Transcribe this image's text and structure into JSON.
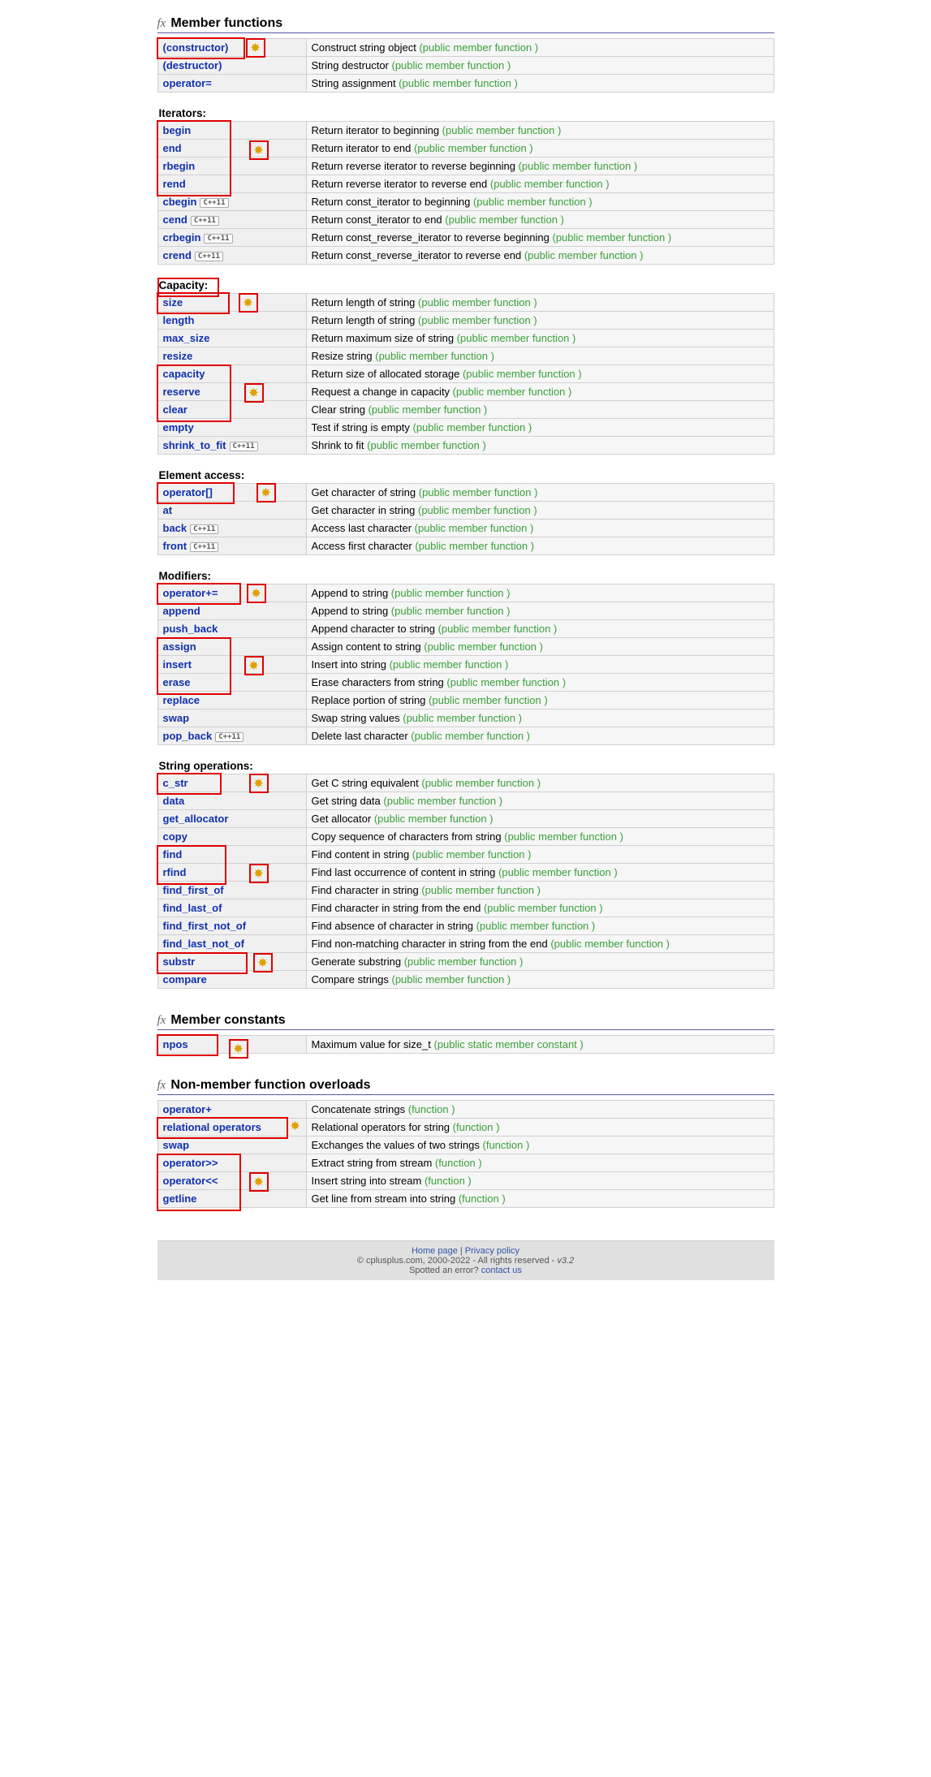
{
  "headings": {
    "member_functions": "Member functions",
    "member_constants": "Member constants",
    "nonmember_overloads": "Non-member function overloads"
  },
  "subheads": {
    "iterators": "Iterators:",
    "capacity": "Capacity:",
    "element_access": "Element access:",
    "modifiers": "Modifiers:",
    "string_operations": "String operations:"
  },
  "type_labels": {
    "pmf": "(public member function )",
    "psmc": "(public static member constant )",
    "fn": "(function )"
  },
  "cpp11_tag": "C++11",
  "member_functions_rows": [
    {
      "name": "(constructor)",
      "desc": "Construct string object",
      "type": "pmf",
      "hl_name": true,
      "star": true
    },
    {
      "name": "(destructor)",
      "desc": "String destructor",
      "type": "pmf"
    },
    {
      "name": "operator=",
      "desc": "String assignment",
      "type": "pmf"
    }
  ],
  "iterators_rows": [
    {
      "name": "begin",
      "desc": "Return iterator to beginning",
      "type": "pmf"
    },
    {
      "name": "end",
      "desc": "Return iterator to end",
      "type": "pmf"
    },
    {
      "name": "rbegin",
      "desc": "Return reverse iterator to reverse beginning",
      "type": "pmf"
    },
    {
      "name": "rend",
      "desc": "Return reverse iterator to reverse end",
      "type": "pmf"
    },
    {
      "name": "cbegin",
      "desc": "Return const_iterator to beginning",
      "type": "pmf",
      "cpp11": true
    },
    {
      "name": "cend",
      "desc": "Return const_iterator to end",
      "type": "pmf",
      "cpp11": true
    },
    {
      "name": "crbegin",
      "desc": "Return const_reverse_iterator to reverse beginning",
      "type": "pmf",
      "cpp11": true
    },
    {
      "name": "crend",
      "desc": "Return const_reverse_iterator to reverse end",
      "type": "pmf",
      "cpp11": true
    }
  ],
  "capacity_rows": [
    {
      "name": "size",
      "desc": "Return length of string",
      "type": "pmf"
    },
    {
      "name": "length",
      "desc": "Return length of string",
      "type": "pmf"
    },
    {
      "name": "max_size",
      "desc": "Return maximum size of string",
      "type": "pmf"
    },
    {
      "name": "resize",
      "desc": "Resize string",
      "type": "pmf"
    },
    {
      "name": "capacity",
      "desc": "Return size of allocated storage",
      "type": "pmf"
    },
    {
      "name": "reserve",
      "desc": "Request a change in capacity",
      "type": "pmf"
    },
    {
      "name": "clear",
      "desc": "Clear string",
      "type": "pmf"
    },
    {
      "name": "empty",
      "desc": "Test if string is empty",
      "type": "pmf"
    },
    {
      "name": "shrink_to_fit",
      "desc": "Shrink to fit",
      "type": "pmf",
      "cpp11": true
    }
  ],
  "element_access_rows": [
    {
      "name": "operator[]",
      "desc": "Get character of string",
      "type": "pmf"
    },
    {
      "name": "at",
      "desc": "Get character in string",
      "type": "pmf"
    },
    {
      "name": "back",
      "desc": "Access last character",
      "type": "pmf",
      "cpp11": true
    },
    {
      "name": "front",
      "desc": "Access first character",
      "type": "pmf",
      "cpp11": true
    }
  ],
  "modifiers_rows": [
    {
      "name": "operator+=",
      "desc": "Append to string",
      "type": "pmf"
    },
    {
      "name": "append",
      "desc": "Append to string",
      "type": "pmf"
    },
    {
      "name": "push_back",
      "desc": "Append character to string",
      "type": "pmf"
    },
    {
      "name": "assign",
      "desc": "Assign content to string",
      "type": "pmf"
    },
    {
      "name": "insert",
      "desc": "Insert into string",
      "type": "pmf"
    },
    {
      "name": "erase",
      "desc": "Erase characters from string",
      "type": "pmf"
    },
    {
      "name": "replace",
      "desc": "Replace portion of string",
      "type": "pmf"
    },
    {
      "name": "swap",
      "desc": "Swap string values",
      "type": "pmf"
    },
    {
      "name": "pop_back",
      "desc": "Delete last character",
      "type": "pmf",
      "cpp11": true
    }
  ],
  "string_ops_rows": [
    {
      "name": "c_str",
      "desc": "Get C string equivalent",
      "type": "pmf"
    },
    {
      "name": "data",
      "desc": "Get string data",
      "type": "pmf"
    },
    {
      "name": "get_allocator",
      "desc": "Get allocator",
      "type": "pmf"
    },
    {
      "name": "copy",
      "desc": "Copy sequence of characters from string",
      "type": "pmf"
    },
    {
      "name": "find",
      "desc": "Find content in string",
      "type": "pmf"
    },
    {
      "name": "rfind",
      "desc": "Find last occurrence of content in string",
      "type": "pmf"
    },
    {
      "name": "find_first_of",
      "desc": "Find character in string",
      "type": "pmf"
    },
    {
      "name": "find_last_of",
      "desc": "Find character in string from the end",
      "type": "pmf"
    },
    {
      "name": "find_first_not_of",
      "desc": "Find absence of character in string",
      "type": "pmf"
    },
    {
      "name": "find_last_not_of",
      "desc": "Find non-matching character in string from the end",
      "type": "pmf"
    },
    {
      "name": "substr",
      "desc": "Generate substring",
      "type": "pmf"
    },
    {
      "name": "compare",
      "desc": "Compare strings",
      "type": "pmf"
    }
  ],
  "member_constants_rows": [
    {
      "name": "npos",
      "desc": "Maximum value for size_t",
      "type": "psmc"
    }
  ],
  "nonmember_rows": [
    {
      "name": "operator+",
      "desc": "Concatenate strings",
      "type": "fn"
    },
    {
      "name": "relational operators",
      "desc": "Relational operators for string",
      "type": "fn"
    },
    {
      "name": "swap",
      "desc": "Exchanges the values of two strings",
      "type": "fn"
    },
    {
      "name": "operator>>",
      "desc": "Extract string from stream",
      "type": "fn"
    },
    {
      "name": "operator<<",
      "desc": "Insert string into stream",
      "type": "fn"
    },
    {
      "name": "getline",
      "desc": "Get line from stream into string",
      "type": "fn"
    }
  ],
  "footer": {
    "home": "Home page",
    "privacy": "Privacy policy",
    "copyright": "© cplusplus.com, 2000-2022 - All rights reserved - ",
    "version": "v3.2",
    "spotted": "Spotted an error? ",
    "contact": "contact us"
  }
}
